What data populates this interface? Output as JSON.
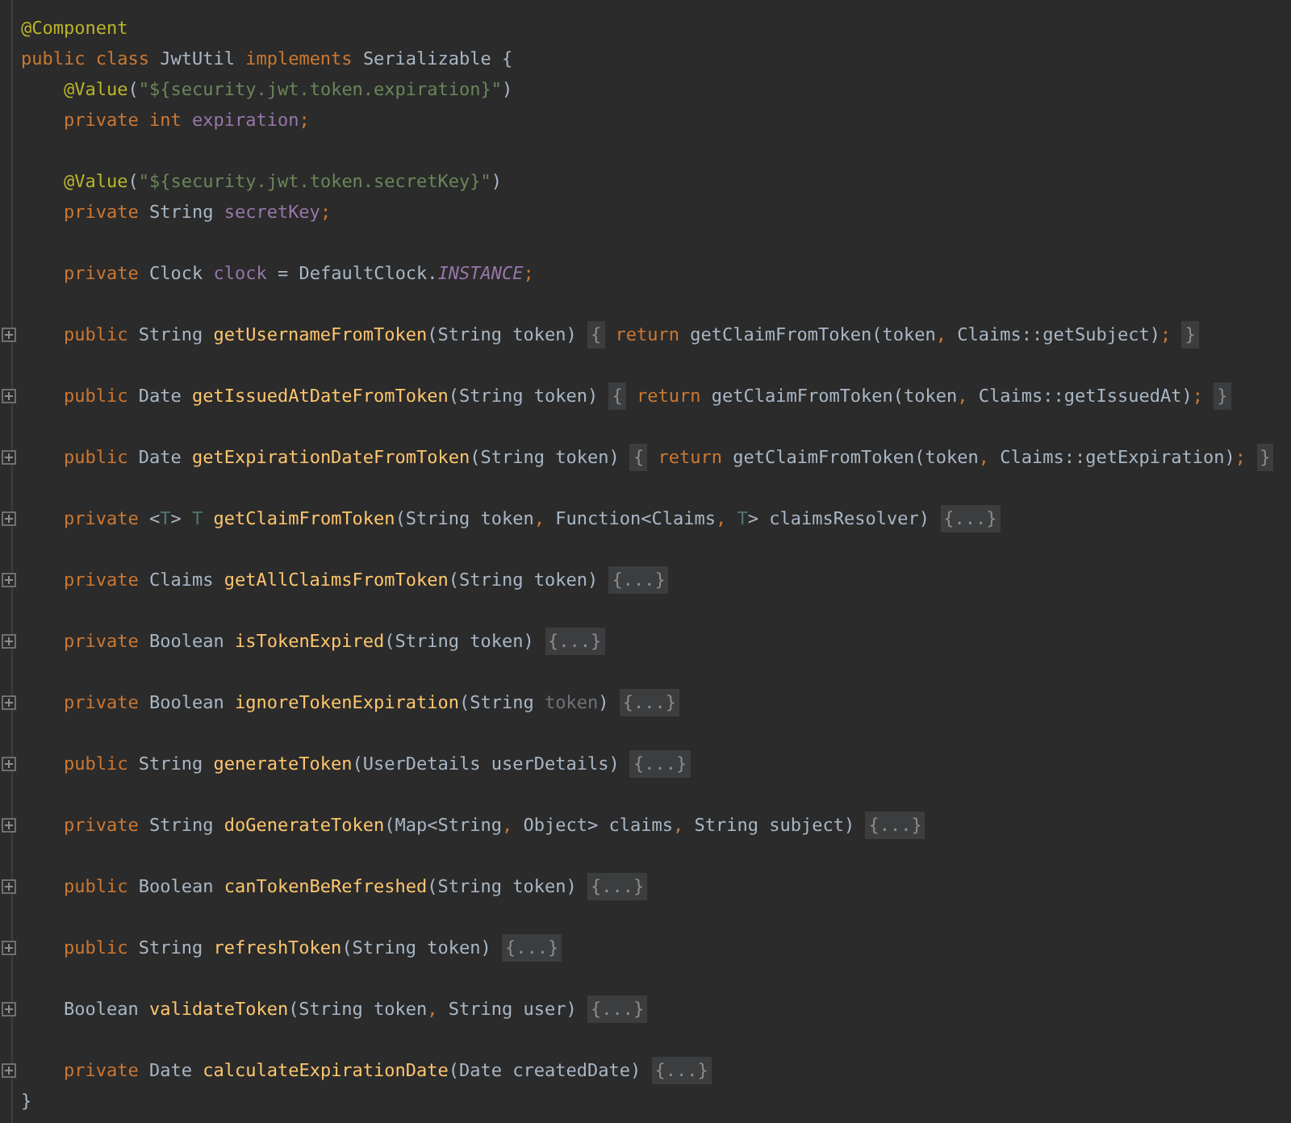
{
  "editor": {
    "lines": [
      {
        "kind": "code",
        "indented": false,
        "fold_marker": false,
        "segments": [
          {
            "kind": "code",
            "tokens": [
              {
                "kind": "a",
                "text": "@Component"
              }
            ]
          }
        ]
      },
      {
        "kind": "code",
        "indented": false,
        "fold_marker": false,
        "segments": [
          {
            "kind": "code",
            "tokens": [
              {
                "kind": "k",
                "text": "public class "
              },
              {
                "kind": "p",
                "text": "JwtUtil "
              },
              {
                "kind": "k",
                "text": "implements "
              },
              {
                "kind": "p",
                "text": "Serializable {"
              }
            ]
          }
        ]
      },
      {
        "kind": "code",
        "indented": true,
        "fold_marker": false,
        "segments": [
          {
            "kind": "code",
            "tokens": [
              {
                "kind": "a",
                "text": "@Value"
              },
              {
                "kind": "p",
                "text": "("
              },
              {
                "kind": "s",
                "text": "\"${security.jwt.token.expiration}\""
              },
              {
                "kind": "p",
                "text": ")"
              }
            ]
          }
        ]
      },
      {
        "kind": "code",
        "indented": true,
        "fold_marker": false,
        "segments": [
          {
            "kind": "code",
            "tokens": [
              {
                "kind": "k",
                "text": "private int "
              },
              {
                "kind": "f",
                "text": "expiration"
              },
              {
                "kind": "k",
                "text": ";"
              }
            ]
          }
        ]
      },
      {
        "kind": "blank"
      },
      {
        "kind": "code",
        "indented": true,
        "fold_marker": false,
        "segments": [
          {
            "kind": "code",
            "tokens": [
              {
                "kind": "a",
                "text": "@Value"
              },
              {
                "kind": "p",
                "text": "("
              },
              {
                "kind": "s",
                "text": "\"${security.jwt.token.secretKey}\""
              },
              {
                "kind": "p",
                "text": ")"
              }
            ]
          }
        ]
      },
      {
        "kind": "code",
        "indented": true,
        "fold_marker": false,
        "segments": [
          {
            "kind": "code",
            "tokens": [
              {
                "kind": "k",
                "text": "private "
              },
              {
                "kind": "p",
                "text": "String "
              },
              {
                "kind": "f",
                "text": "secretKey"
              },
              {
                "kind": "k",
                "text": ";"
              }
            ]
          }
        ]
      },
      {
        "kind": "blank"
      },
      {
        "kind": "code",
        "indented": true,
        "fold_marker": false,
        "segments": [
          {
            "kind": "code",
            "tokens": [
              {
                "kind": "k",
                "text": "private "
              },
              {
                "kind": "p",
                "text": "Clock "
              },
              {
                "kind": "f",
                "text": "clock"
              },
              {
                "kind": "p",
                "text": " = DefaultClock."
              },
              {
                "kind": "st",
                "text": "INSTANCE"
              },
              {
                "kind": "k",
                "text": ";"
              }
            ]
          }
        ]
      },
      {
        "kind": "blank"
      },
      {
        "kind": "code",
        "indented": true,
        "fold_marker": true,
        "segments": [
          {
            "kind": "code",
            "tokens": [
              {
                "kind": "k",
                "text": "public "
              },
              {
                "kind": "p",
                "text": "String "
              },
              {
                "kind": "m",
                "text": "getUsernameFromToken"
              },
              {
                "kind": "p",
                "text": "(String token)"
              }
            ]
          },
          {
            "kind": "fold",
            "text": "{"
          },
          {
            "kind": "code",
            "tokens": [
              {
                "kind": "k",
                "text": "return "
              },
              {
                "kind": "p",
                "text": "getClaimFromToken(token"
              },
              {
                "kind": "k",
                "text": ", "
              },
              {
                "kind": "p",
                "text": "Claims::getSubject)"
              },
              {
                "kind": "k",
                "text": ";"
              }
            ]
          },
          {
            "kind": "fold",
            "text": "}"
          }
        ]
      },
      {
        "kind": "blank"
      },
      {
        "kind": "code",
        "indented": true,
        "fold_marker": true,
        "segments": [
          {
            "kind": "code",
            "tokens": [
              {
                "kind": "k",
                "text": "public "
              },
              {
                "kind": "p",
                "text": "Date "
              },
              {
                "kind": "m",
                "text": "getIssuedAtDateFromToken"
              },
              {
                "kind": "p",
                "text": "(String token)"
              }
            ]
          },
          {
            "kind": "fold",
            "text": "{"
          },
          {
            "kind": "code",
            "tokens": [
              {
                "kind": "k",
                "text": "return "
              },
              {
                "kind": "p",
                "text": "getClaimFromToken(token"
              },
              {
                "kind": "k",
                "text": ", "
              },
              {
                "kind": "p",
                "text": "Claims::getIssuedAt)"
              },
              {
                "kind": "k",
                "text": ";"
              }
            ]
          },
          {
            "kind": "fold",
            "text": "}"
          }
        ]
      },
      {
        "kind": "blank"
      },
      {
        "kind": "code",
        "indented": true,
        "fold_marker": true,
        "segments": [
          {
            "kind": "code",
            "tokens": [
              {
                "kind": "k",
                "text": "public "
              },
              {
                "kind": "p",
                "text": "Date "
              },
              {
                "kind": "m",
                "text": "getExpirationDateFromToken"
              },
              {
                "kind": "p",
                "text": "(String token)"
              }
            ]
          },
          {
            "kind": "fold",
            "text": "{"
          },
          {
            "kind": "code",
            "tokens": [
              {
                "kind": "k",
                "text": "return "
              },
              {
                "kind": "p",
                "text": "getClaimFromToken(token"
              },
              {
                "kind": "k",
                "text": ", "
              },
              {
                "kind": "p",
                "text": "Claims::getExpiration)"
              },
              {
                "kind": "k",
                "text": ";"
              }
            ]
          },
          {
            "kind": "fold",
            "text": "}"
          }
        ]
      },
      {
        "kind": "blank"
      },
      {
        "kind": "code",
        "indented": true,
        "fold_marker": true,
        "segments": [
          {
            "kind": "code",
            "tokens": [
              {
                "kind": "k",
                "text": "private "
              },
              {
                "kind": "p",
                "text": "<"
              },
              {
                "kind": "tp",
                "text": "T"
              },
              {
                "kind": "p",
                "text": "> "
              },
              {
                "kind": "tp",
                "text": "T "
              },
              {
                "kind": "m",
                "text": "getClaimFromToken"
              },
              {
                "kind": "p",
                "text": "(String token"
              },
              {
                "kind": "k",
                "text": ", "
              },
              {
                "kind": "p",
                "text": "Function<Claims"
              },
              {
                "kind": "k",
                "text": ", "
              },
              {
                "kind": "tp",
                "text": "T"
              },
              {
                "kind": "p",
                "text": "> claimsResolver)"
              }
            ]
          },
          {
            "kind": "fold",
            "text": "{...}"
          }
        ]
      },
      {
        "kind": "blank"
      },
      {
        "kind": "code",
        "indented": true,
        "fold_marker": true,
        "segments": [
          {
            "kind": "code",
            "tokens": [
              {
                "kind": "k",
                "text": "private "
              },
              {
                "kind": "p",
                "text": "Claims "
              },
              {
                "kind": "m",
                "text": "getAllClaimsFromToken"
              },
              {
                "kind": "p",
                "text": "(String token)"
              }
            ]
          },
          {
            "kind": "fold",
            "text": "{...}"
          }
        ]
      },
      {
        "kind": "blank"
      },
      {
        "kind": "code",
        "indented": true,
        "fold_marker": true,
        "segments": [
          {
            "kind": "code",
            "tokens": [
              {
                "kind": "k",
                "text": "private "
              },
              {
                "kind": "p",
                "text": "Boolean "
              },
              {
                "kind": "m",
                "text": "isTokenExpired"
              },
              {
                "kind": "p",
                "text": "(String token)"
              }
            ]
          },
          {
            "kind": "fold",
            "text": "{...}"
          }
        ]
      },
      {
        "kind": "blank"
      },
      {
        "kind": "code",
        "indented": true,
        "fold_marker": true,
        "segments": [
          {
            "kind": "code",
            "tokens": [
              {
                "kind": "k",
                "text": "private "
              },
              {
                "kind": "p",
                "text": "Boolean "
              },
              {
                "kind": "m",
                "text": "ignoreTokenExpiration"
              },
              {
                "kind": "p",
                "text": "(String "
              },
              {
                "kind": "u",
                "text": "token"
              },
              {
                "kind": "p",
                "text": ")"
              }
            ]
          },
          {
            "kind": "fold",
            "text": "{...}"
          }
        ]
      },
      {
        "kind": "blank"
      },
      {
        "kind": "code",
        "indented": true,
        "fold_marker": true,
        "segments": [
          {
            "kind": "code",
            "tokens": [
              {
                "kind": "k",
                "text": "public "
              },
              {
                "kind": "p",
                "text": "String "
              },
              {
                "kind": "m",
                "text": "generateToken"
              },
              {
                "kind": "p",
                "text": "(UserDetails userDetails)"
              }
            ]
          },
          {
            "kind": "fold",
            "text": "{...}"
          }
        ]
      },
      {
        "kind": "blank"
      },
      {
        "kind": "code",
        "indented": true,
        "fold_marker": true,
        "segments": [
          {
            "kind": "code",
            "tokens": [
              {
                "kind": "k",
                "text": "private "
              },
              {
                "kind": "p",
                "text": "String "
              },
              {
                "kind": "m",
                "text": "doGenerateToken"
              },
              {
                "kind": "p",
                "text": "(Map<String"
              },
              {
                "kind": "k",
                "text": ", "
              },
              {
                "kind": "p",
                "text": "Object> claims"
              },
              {
                "kind": "k",
                "text": ", "
              },
              {
                "kind": "p",
                "text": "String subject)"
              }
            ]
          },
          {
            "kind": "fold",
            "text": "{...}"
          }
        ]
      },
      {
        "kind": "blank"
      },
      {
        "kind": "code",
        "indented": true,
        "fold_marker": true,
        "segments": [
          {
            "kind": "code",
            "tokens": [
              {
                "kind": "k",
                "text": "public "
              },
              {
                "kind": "p",
                "text": "Boolean "
              },
              {
                "kind": "m",
                "text": "canTokenBeRefreshed"
              },
              {
                "kind": "p",
                "text": "(String token)"
              }
            ]
          },
          {
            "kind": "fold",
            "text": "{...}"
          }
        ]
      },
      {
        "kind": "blank"
      },
      {
        "kind": "code",
        "indented": true,
        "fold_marker": true,
        "segments": [
          {
            "kind": "code",
            "tokens": [
              {
                "kind": "k",
                "text": "public "
              },
              {
                "kind": "p",
                "text": "String "
              },
              {
                "kind": "m",
                "text": "refreshToken"
              },
              {
                "kind": "p",
                "text": "(String token)"
              }
            ]
          },
          {
            "kind": "fold",
            "text": "{...}"
          }
        ]
      },
      {
        "kind": "blank"
      },
      {
        "kind": "code",
        "indented": true,
        "fold_marker": true,
        "segments": [
          {
            "kind": "code",
            "tokens": [
              {
                "kind": "p",
                "text": "Boolean "
              },
              {
                "kind": "m",
                "text": "validateToken"
              },
              {
                "kind": "p",
                "text": "(String token"
              },
              {
                "kind": "k",
                "text": ", "
              },
              {
                "kind": "p",
                "text": "String user)"
              }
            ]
          },
          {
            "kind": "fold",
            "text": "{...}"
          }
        ]
      },
      {
        "kind": "blank"
      },
      {
        "kind": "code",
        "indented": true,
        "fold_marker": true,
        "segments": [
          {
            "kind": "code",
            "tokens": [
              {
                "kind": "k",
                "text": "private "
              },
              {
                "kind": "p",
                "text": "Date "
              },
              {
                "kind": "m",
                "text": "calculateExpirationDate"
              },
              {
                "kind": "p",
                "text": "(Date createdDate)"
              }
            ]
          },
          {
            "kind": "fold",
            "text": "{...}"
          }
        ]
      },
      {
        "kind": "code",
        "indented": false,
        "fold_marker": false,
        "segments": [
          {
            "kind": "code",
            "tokens": [
              {
                "kind": "p",
                "text": "}"
              }
            ]
          }
        ]
      }
    ]
  }
}
